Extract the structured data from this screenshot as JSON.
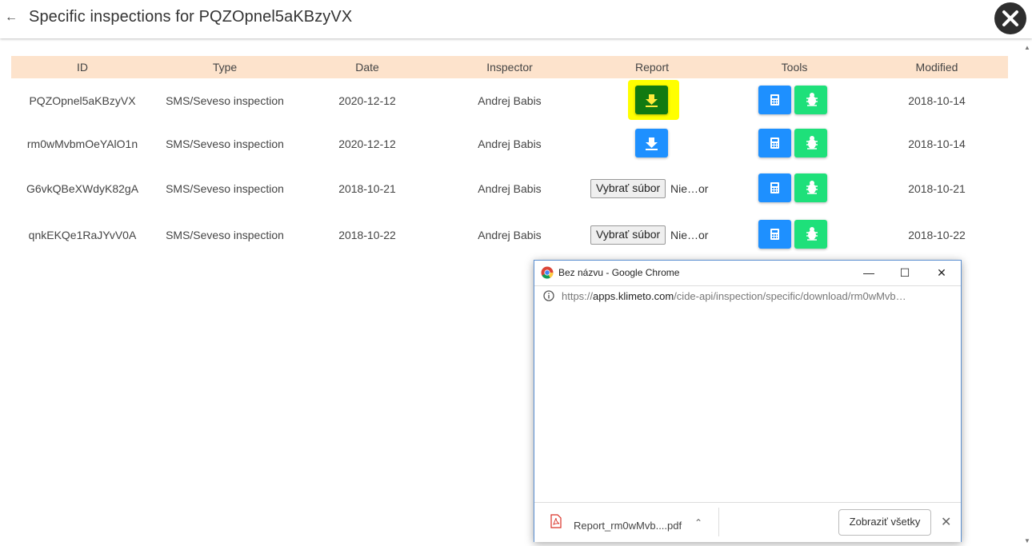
{
  "header": {
    "back_icon": "arrow-left-icon",
    "title": "Specific inspections for PQZOpnel5aKBzyVX",
    "close_icon": "close-icon"
  },
  "table": {
    "columns": [
      "ID",
      "Type",
      "Date",
      "Inspector",
      "Report",
      "Tools",
      "Modified"
    ],
    "rows": [
      {
        "id": "PQZOpnel5aKBzyVX",
        "type": "SMS/Seveso inspection",
        "date": "2020-12-12",
        "inspector": "Andrej Babis",
        "report": "download",
        "modified": "2018-10-14"
      },
      {
        "id": "rm0wMvbmOeYAlO1n",
        "type": "SMS/Seveso inspection",
        "date": "2020-12-12",
        "inspector": "Andrej Babis",
        "report": "download",
        "modified": "2018-10-14"
      },
      {
        "id": "G6vkQBeXWdyK82gA",
        "type": "SMS/Seveso inspection",
        "date": "2018-10-21",
        "inspector": "Andrej Babis",
        "report": "file",
        "file_button": "Vybrať súbor",
        "file_status": "Nie…or",
        "modified": "2018-10-21"
      },
      {
        "id": "qnkEKQe1RaJYvV0A",
        "type": "SMS/Seveso inspection",
        "date": "2018-10-22",
        "inspector": "Andrej Babis",
        "report": "file",
        "file_button": "Vybrať súbor",
        "file_status": "Nie…or",
        "modified": "2018-10-22"
      }
    ]
  },
  "popup": {
    "title": "Bez názvu - Google Chrome",
    "url_scheme": "https://",
    "url_host": "apps.klimeto.com",
    "url_path": "/cide-api/inspection/specific/download/rm0wMvb…",
    "minimize": "—",
    "restore": "☐",
    "close": "✕",
    "download_file": "Report_rm0wMvb....pdf",
    "show_all": "Zobraziť všetky",
    "shelf_close": "✕"
  },
  "colors": {
    "header_row_bg": "#fde3cc",
    "download_blue": "#1e90ff",
    "download_active_green": "#117a11",
    "highlight_yellow": "#ffff00",
    "calc_blue": "#1e90ff",
    "bug_green": "#1ee07a"
  }
}
